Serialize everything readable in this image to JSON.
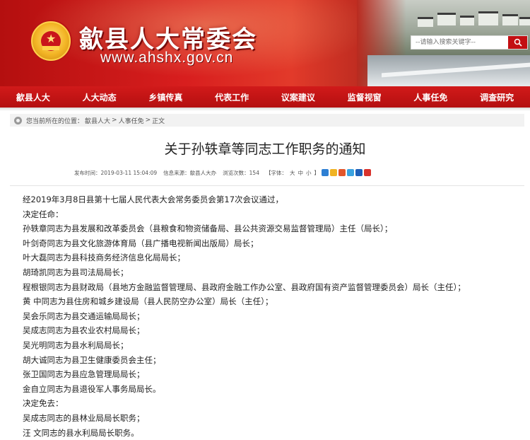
{
  "header": {
    "site_title": "歙县人大常委会",
    "site_url": "www.ahshx.gov.cn",
    "search_placeholder": "--请输入搜索关键字--",
    "accent_color": "#c30f12"
  },
  "nav": {
    "items": [
      "歙县人大",
      "人大动态",
      "乡镇传真",
      "代表工作",
      "议案建议",
      "监督视窗",
      "人事任免",
      "调查研究"
    ]
  },
  "breadcrumb": {
    "prefix": "您当前所在的位置：",
    "items": [
      "歙县人大",
      "人事任免",
      "正文"
    ],
    "separator": ">"
  },
  "article": {
    "title": "关于孙轶章等同志工作职务的通知",
    "meta": {
      "publish_time": "发布时间：2019-03-11 15:04:09",
      "source": "信息来源：歙县人大办",
      "views": "浏览次数：154",
      "font_label": "【字体：",
      "font_large": "大",
      "font_medium": "中",
      "font_small": "小",
      "font_close": "】"
    },
    "share_icons": [
      "share-plus-icon",
      "share-qzone-icon",
      "share-weibo-icon",
      "share-tencent-icon",
      "share-people-icon",
      "share-renren-icon"
    ],
    "paragraphs": [
      "经2019年3月8日县第十七届人民代表大会常务委员会第17次会议通过，",
      "决定任命：",
      "孙轶章同志为县发展和改革委员会（县粮食和物资储备局、县公共资源交易监督管理局）主任（局长）；",
      "叶剑奇同志为县文化旅游体育局（县广播电视新闻出版局）局长；",
      "叶大磊同志为县科技商务经济信息化局局长；",
      "胡琦凯同志为县司法局局长；",
      "程根银同志为县财政局（县地方金融监督管理局、县政府金融工作办公室、县政府国有资产监督管理委员会）局长（主任）；",
      "黄  中同志为县住房和城乡建设局（县人民防空办公室）局长（主任）；",
      "吴会乐同志为县交通运输局局长；",
      "吴成志同志为县农业农村局局长；",
      "吴光明同志为县水利局局长；",
      "胡大诚同志为县卫生健康委员会主任；",
      "张卫国同志为县应急管理局局长；",
      "金自立同志为县退役军人事务局局长。",
      "决定免去：",
      "吴成志同志的县林业局局长职务；",
      "汪  文同志的县水利局局长职务。"
    ]
  }
}
